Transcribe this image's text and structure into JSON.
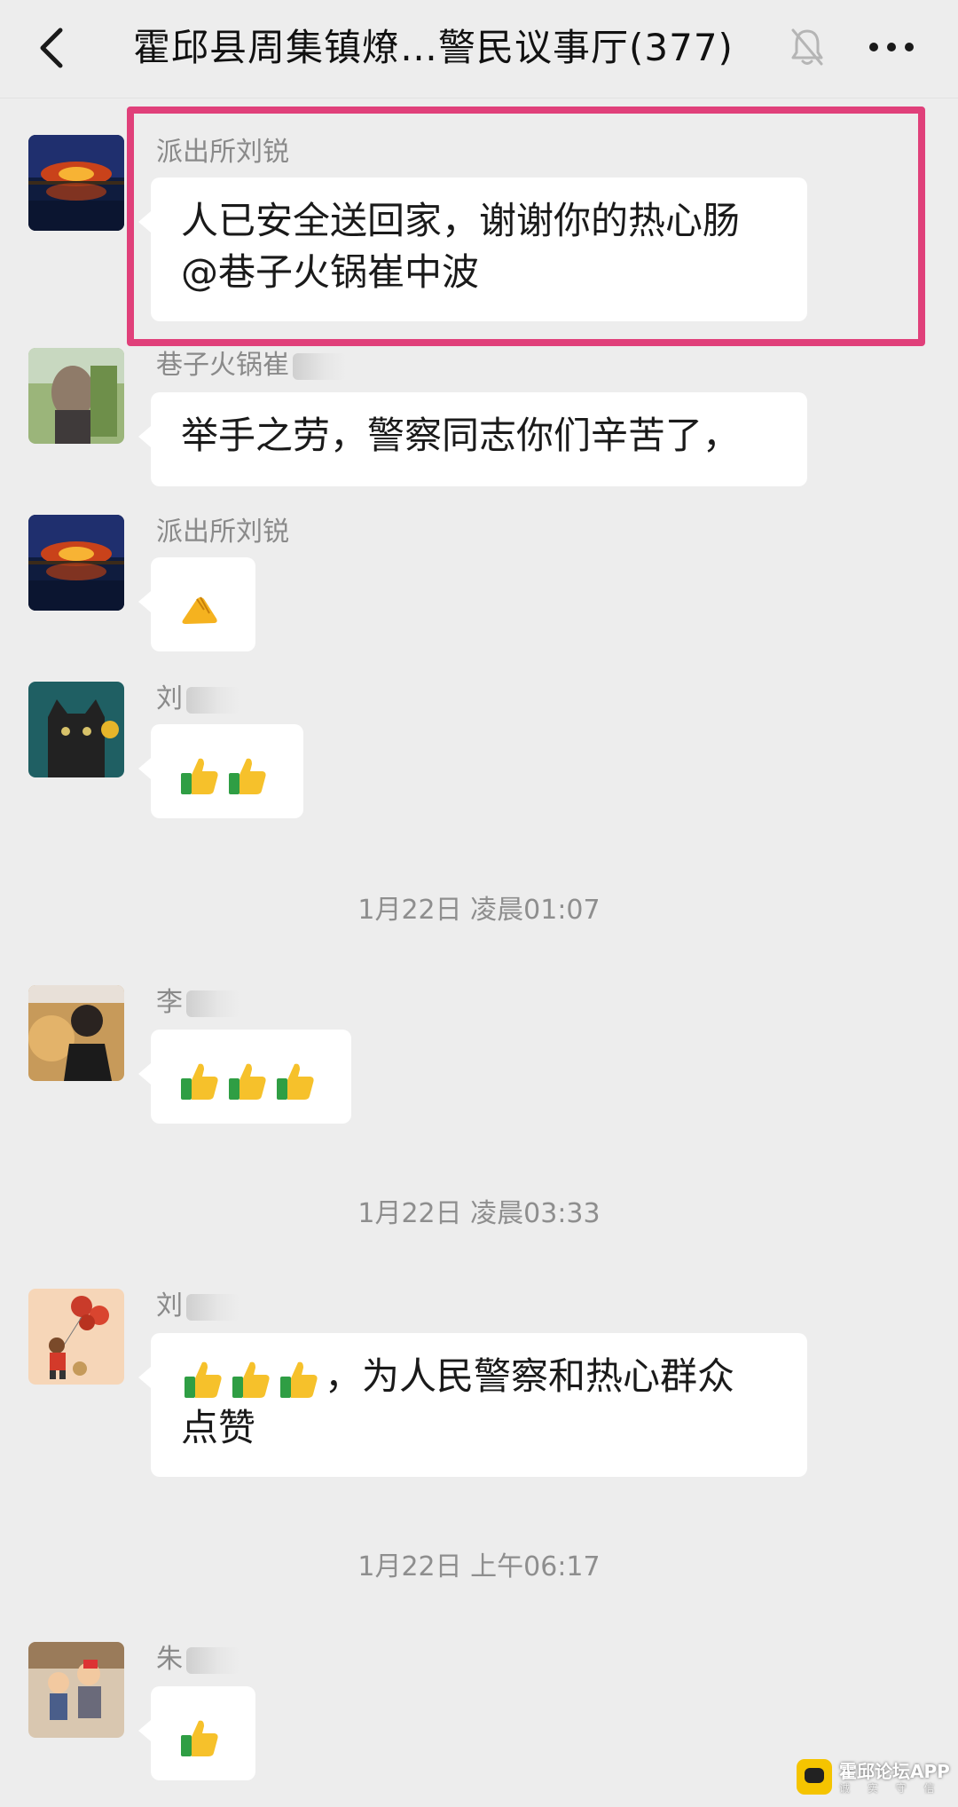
{
  "header": {
    "title": "霍邱县周集镇燎…警民议事厅(377)",
    "back_icon": "chevron-left-icon",
    "mute_icon": "bell-off-icon",
    "more_icon": "more-dots-icon"
  },
  "messages": [
    {
      "sender": "派出所刘锐",
      "text": "人已安全送回家，谢谢你的热心肠\n@巷子火锅崔中波",
      "highlighted": true
    },
    {
      "sender": "巷子火锅崔",
      "text": "举手之劳，警察同志你们辛苦了，"
    },
    {
      "sender": "派出所刘锐",
      "emoji": [
        "handshake-icon"
      ]
    },
    {
      "sender": "刘",
      "emoji": [
        "thumbs-up-icon",
        "thumbs-up-icon"
      ]
    },
    {
      "sender": "李",
      "emoji": [
        "thumbs-up-icon",
        "thumbs-up-icon",
        "thumbs-up-icon"
      ]
    },
    {
      "sender": "刘",
      "text": "，为人民警察和热心群众\n点赞",
      "emoji": [
        "thumbs-up-icon",
        "thumbs-up-icon",
        "thumbs-up-icon"
      ]
    },
    {
      "sender": "朱",
      "emoji": [
        "thumbs-up-icon"
      ]
    }
  ],
  "timestamps": [
    "1月22日 凌晨01:07",
    "1月22日 凌晨03:33",
    "1月22日 上午06:17"
  ],
  "watermark": {
    "text": "霍邱论坛APP",
    "sub": "诚 实 守 信"
  },
  "colors": {
    "background": "#ededed",
    "bubble": "#ffffff",
    "highlight": "#e0407a",
    "meta_text": "#8e8e8e"
  }
}
